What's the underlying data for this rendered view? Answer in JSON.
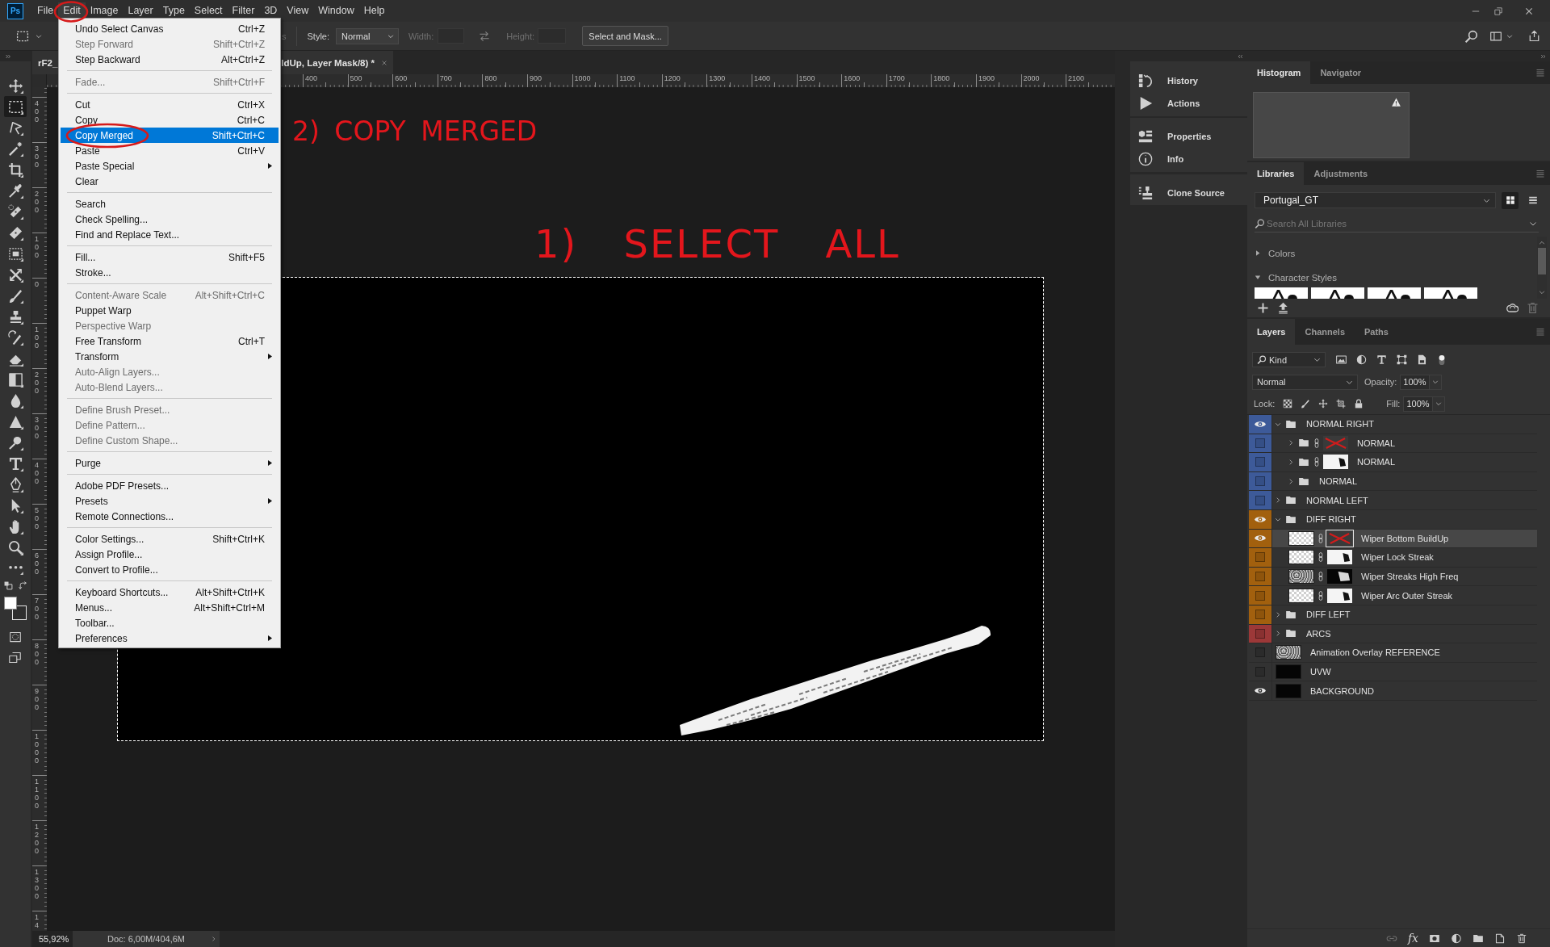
{
  "menu_bar": {
    "logo": "Ps",
    "items": [
      {
        "label": "File",
        "selected": false
      },
      {
        "label": "Edit",
        "selected": true
      },
      {
        "label": "Image",
        "selected": false
      },
      {
        "label": "Layer",
        "selected": false
      },
      {
        "label": "Type",
        "selected": false
      },
      {
        "label": "Select",
        "selected": false
      },
      {
        "label": "Filter",
        "selected": false
      },
      {
        "label": "3D",
        "selected": false
      },
      {
        "label": "View",
        "selected": false
      },
      {
        "label": "Window",
        "selected": false
      },
      {
        "label": "Help",
        "selected": false
      }
    ]
  },
  "options_bar": {
    "fragment": "s",
    "style": {
      "label": "Style:",
      "value": "Normal"
    },
    "width": {
      "label": "Width:",
      "disabled": true
    },
    "height": {
      "label": "Height:",
      "disabled": true
    },
    "button": "Select and Mask..."
  },
  "document_tab": {
    "title_start": "rF2_",
    "title_end": "ldUp, Layer Mask/8) *"
  },
  "rulers": {
    "horizontal": [
      "400",
      "500",
      "600",
      "700",
      "800",
      "900",
      "1000",
      "1100",
      "1200",
      "1300",
      "1400",
      "1500",
      "1600",
      "1700",
      "1800",
      "1900",
      "2000",
      "2100"
    ],
    "vertical": [
      "400",
      "300",
      "200",
      "100",
      "0",
      "100",
      "200",
      "300",
      "400",
      "500",
      "600",
      "700",
      "800",
      "900",
      "1000",
      "1100",
      "1200",
      "1300",
      "14"
    ]
  },
  "canvas": {
    "annotations": [
      "2) COPY MERGED",
      "1) SELECT ALL"
    ]
  },
  "status_bar": {
    "zoom": "55,92%",
    "document": "Doc: 6,00M/404,6M"
  },
  "toolbar": {
    "tools": [
      {
        "kind": "move",
        "selected": false
      },
      {
        "kind": "marquee",
        "selected": true
      },
      {
        "kind": "lasso",
        "selected": false
      },
      {
        "kind": "wand",
        "selected": false
      },
      {
        "kind": "crop",
        "selected": false
      },
      {
        "kind": "eyedropper",
        "selected": false
      },
      {
        "kind": "spotheal",
        "selected": false
      },
      {
        "kind": "heal",
        "selected": false
      },
      {
        "kind": "patch",
        "selected": false
      },
      {
        "kind": "cross",
        "selected": false
      },
      {
        "kind": "brush",
        "selected": false
      },
      {
        "kind": "stamp",
        "selected": false
      },
      {
        "kind": "historybrush",
        "selected": false
      },
      {
        "kind": "eraser",
        "selected": false
      },
      {
        "kind": "gradient",
        "selected": false
      },
      {
        "kind": "blur",
        "selected": false
      },
      {
        "kind": "sharpen",
        "selected": false
      },
      {
        "kind": "dodge",
        "selected": false
      },
      {
        "kind": "type",
        "selected": false
      },
      {
        "kind": "pen",
        "selected": false
      },
      {
        "kind": "pointer",
        "selected": false
      },
      {
        "kind": "hand",
        "selected": false
      },
      {
        "kind": "zoom",
        "selected": false
      },
      {
        "kind": "more",
        "selected": false
      }
    ],
    "swatches": [
      {
        "color": "#ffffff"
      },
      {
        "color": "#2e2e2e"
      }
    ]
  },
  "edit_menu": {
    "sections": [
      {
        "items": [
          {
            "label": "Undo Select Canvas",
            "shortcut": "Ctrl+Z",
            "disabled": false,
            "selected": false,
            "submenu": false
          },
          {
            "label": "Step Forward",
            "shortcut": "Shift+Ctrl+Z",
            "disabled": true,
            "selected": false,
            "submenu": false
          },
          {
            "label": "Step Backward",
            "shortcut": "Alt+Ctrl+Z",
            "disabled": false,
            "selected": false,
            "submenu": false
          }
        ]
      },
      {
        "items": [
          {
            "label": "Fade...",
            "shortcut": "Shift+Ctrl+F",
            "disabled": true,
            "selected": false,
            "submenu": false
          }
        ]
      },
      {
        "items": [
          {
            "label": "Cut",
            "shortcut": "Ctrl+X",
            "disabled": false,
            "selected": false,
            "submenu": false
          },
          {
            "label": "Copy",
            "shortcut": "Ctrl+C",
            "disabled": false,
            "selected": false,
            "submenu": false
          },
          {
            "label": "Copy Merged",
            "shortcut": "Shift+Ctrl+C",
            "disabled": false,
            "selected": true,
            "submenu": false
          },
          {
            "label": "Paste",
            "shortcut": "Ctrl+V",
            "disabled": false,
            "selected": false,
            "submenu": false
          },
          {
            "label": "Paste Special",
            "disabled": false,
            "selected": false,
            "submenu": true
          },
          {
            "label": "Clear",
            "disabled": false,
            "selected": false,
            "submenu": false
          }
        ]
      },
      {
        "items": [
          {
            "label": "Search",
            "disabled": false,
            "selected": false,
            "submenu": false
          },
          {
            "label": "Check Spelling...",
            "disabled": false,
            "selected": false,
            "submenu": false
          },
          {
            "label": "Find and Replace Text...",
            "disabled": false,
            "selected": false,
            "submenu": false
          }
        ]
      },
      {
        "items": [
          {
            "label": "Fill...",
            "shortcut": "Shift+F5",
            "disabled": false,
            "selected": false,
            "submenu": false
          },
          {
            "label": "Stroke...",
            "disabled": false,
            "selected": false,
            "submenu": false
          }
        ]
      },
      {
        "items": [
          {
            "label": "Content-Aware Scale",
            "shortcut": "Alt+Shift+Ctrl+C",
            "disabled": true,
            "selected": false,
            "submenu": false
          },
          {
            "label": "Puppet Warp",
            "disabled": false,
            "selected": false,
            "submenu": false
          },
          {
            "label": "Perspective Warp",
            "disabled": true,
            "selected": false,
            "submenu": false
          },
          {
            "label": "Free Transform",
            "shortcut": "Ctrl+T",
            "disabled": false,
            "selected": false,
            "submenu": false
          },
          {
            "label": "Transform",
            "disabled": false,
            "selected": false,
            "submenu": true
          },
          {
            "label": "Auto-Align Layers...",
            "disabled": true,
            "selected": false,
            "submenu": false
          },
          {
            "label": "Auto-Blend Layers...",
            "disabled": true,
            "selected": false,
            "submenu": false
          }
        ]
      },
      {
        "items": [
          {
            "label": "Define Brush Preset...",
            "disabled": true,
            "selected": false,
            "submenu": false
          },
          {
            "label": "Define Pattern...",
            "disabled": true,
            "selected": false,
            "submenu": false
          },
          {
            "label": "Define Custom Shape...",
            "disabled": true,
            "selected": false,
            "submenu": false
          }
        ]
      },
      {
        "items": [
          {
            "label": "Purge",
            "disabled": false,
            "selected": false,
            "submenu": true
          }
        ]
      },
      {
        "items": [
          {
            "label": "Adobe PDF Presets...",
            "disabled": false,
            "selected": false,
            "submenu": false
          },
          {
            "label": "Presets",
            "disabled": false,
            "selected": false,
            "submenu": true
          },
          {
            "label": "Remote Connections...",
            "disabled": false,
            "selected": false,
            "submenu": false
          }
        ]
      },
      {
        "items": [
          {
            "label": "Color Settings...",
            "shortcut": "Shift+Ctrl+K",
            "disabled": false,
            "selected": false,
            "submenu": false
          },
          {
            "label": "Assign Profile...",
            "disabled": false,
            "selected": false,
            "submenu": false
          },
          {
            "label": "Convert to Profile...",
            "disabled": false,
            "selected": false,
            "submenu": false
          }
        ]
      },
      {
        "items": [
          {
            "label": "Keyboard Shortcuts...",
            "shortcut": "Alt+Shift+Ctrl+K",
            "disabled": false,
            "selected": false,
            "submenu": false
          },
          {
            "label": "Menus...",
            "shortcut": "Alt+Shift+Ctrl+M",
            "disabled": false,
            "selected": false,
            "submenu": false
          },
          {
            "label": "Toolbar...",
            "disabled": false,
            "selected": false,
            "submenu": false
          },
          {
            "label": "Preferences",
            "disabled": false,
            "selected": false,
            "submenu": true
          }
        ]
      }
    ]
  },
  "dock": {
    "groups": [
      {
        "items": [
          {
            "kind": "history",
            "label": "History"
          },
          {
            "kind": "actions",
            "label": "Actions"
          }
        ]
      },
      {
        "items": [
          {
            "kind": "properties",
            "label": "Properties"
          },
          {
            "kind": "info",
            "label": "Info"
          }
        ]
      },
      {
        "items": [
          {
            "kind": "clone",
            "label": "Clone Source"
          }
        ]
      }
    ]
  },
  "histogram_panel": {
    "tabs": [
      {
        "label": "Histogram",
        "selected": true
      },
      {
        "label": "Navigator",
        "selected": false
      }
    ]
  },
  "libraries_panel": {
    "tabs": [
      {
        "label": "Libraries",
        "selected": true
      },
      {
        "label": "Adjustments",
        "selected": false
      }
    ],
    "library": "Portugal_GT",
    "views": [
      {
        "kind": "grid",
        "selected": true
      },
      {
        "kind": "list",
        "selected": false
      }
    ],
    "search": {
      "placeholder": "Search All Libraries"
    },
    "sections": [
      {
        "label": "Colors",
        "expanded": false
      },
      {
        "label": "Character Styles",
        "expanded": true
      }
    ]
  },
  "layers_panel": {
    "tabs": [
      {
        "label": "Layers",
        "selected": true
      },
      {
        "label": "Channels",
        "selected": false
      },
      {
        "label": "Paths",
        "selected": false
      }
    ],
    "filter": "Kind",
    "blend_mode": "Normal",
    "opacity": {
      "label": "Opacity:",
      "value": "100%"
    },
    "lock_label": "Lock:",
    "fill": {
      "label": "Fill:",
      "value": "100%"
    },
    "effects_button": "fx",
    "layers": [
      {
        "name": "NORMAL RIGHT",
        "kind": "group",
        "visible": true,
        "color": "#3d5a99",
        "expanded": true,
        "selected": false,
        "children": [
          {
            "name": "NORMAL",
            "kind": "group",
            "visible": false,
            "color": "#3d5a99",
            "expanded": false,
            "selected": false,
            "mask": {
              "kind": "crossed"
            }
          },
          {
            "name": "NORMAL",
            "kind": "group",
            "visible": false,
            "color": "#3d5a99",
            "expanded": false,
            "selected": false,
            "mask": {
              "kind": "light"
            }
          },
          {
            "name": "NORMAL",
            "kind": "group",
            "visible": false,
            "color": "#3d5a99",
            "expanded": false,
            "selected": false
          }
        ]
      },
      {
        "name": "NORMAL LEFT",
        "kind": "group",
        "visible": false,
        "color": "#3d5a99",
        "expanded": false,
        "selected": false
      },
      {
        "name": "DIFF RIGHT",
        "kind": "group",
        "visible": true,
        "color": "#a2600e",
        "expanded": true,
        "selected": false,
        "children": [
          {
            "name": "Wiper Bottom BuildUp",
            "kind": "layer",
            "visible": true,
            "color": "#a2600e",
            "selected": true,
            "thumbnail": {
              "kind": "transparent"
            },
            "mask": {
              "kind": "crossed"
            }
          },
          {
            "name": "Wiper Lock Streak",
            "kind": "layer",
            "visible": false,
            "color": "#a2600e",
            "selected": false,
            "thumbnail": {
              "kind": "transparent"
            },
            "mask": {
              "kind": "light"
            }
          },
          {
            "name": "Wiper Streaks High Freq",
            "kind": "layer",
            "visible": false,
            "color": "#a2600e",
            "selected": false,
            "thumbnail": {
              "kind": "texture"
            },
            "mask": {
              "kind": "dark"
            }
          },
          {
            "name": "Wiper Arc Outer Streak",
            "kind": "layer",
            "visible": false,
            "color": "#a2600e",
            "selected": false,
            "thumbnail": {
              "kind": "transparent"
            },
            "mask": {
              "kind": "light"
            }
          }
        ]
      },
      {
        "name": "DIFF LEFT",
        "kind": "group",
        "visible": false,
        "color": "#a2600e",
        "expanded": false,
        "selected": false
      },
      {
        "name": "ARCS",
        "kind": "group",
        "visible": false,
        "color": "#9c3838",
        "expanded": false,
        "selected": false
      },
      {
        "name": "Animation Overlay REFERENCE",
        "kind": "layer",
        "visible": false,
        "selected": false,
        "thumbnail": {
          "kind": "texture"
        }
      },
      {
        "name": "UVW",
        "kind": "layer",
        "visible": false,
        "selected": false,
        "thumbnail": {
          "kind": "dark"
        }
      },
      {
        "name": "BACKGROUND",
        "kind": "layer",
        "visible": true,
        "selected": false,
        "thumbnail": {
          "kind": "dark"
        }
      }
    ]
  }
}
